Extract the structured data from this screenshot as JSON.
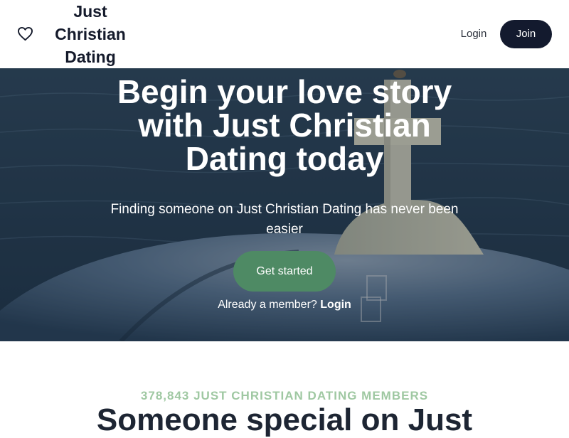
{
  "header": {
    "brand_lines": [
      "Just",
      "Christian",
      "Dating"
    ],
    "login_label": "Login",
    "join_label": "Join"
  },
  "hero": {
    "title_lines": [
      "Begin your love story",
      "with Just Christian",
      "Dating today"
    ],
    "subtitle_lines": [
      "Finding someone on Just Christian Dating has never been",
      "easier"
    ],
    "cta_label": "Get started",
    "member_prompt": "Already a member?",
    "member_login_label": "Login"
  },
  "members_section": {
    "count_label": "378,843 JUST CHRISTIAN DATING MEMBERS",
    "title": "Someone special on Just"
  },
  "colors": {
    "join_bg": "#131a2e",
    "cta_bg": "#4e8a64",
    "members_count": "#9fc8a2",
    "title_text": "#1d2533"
  }
}
